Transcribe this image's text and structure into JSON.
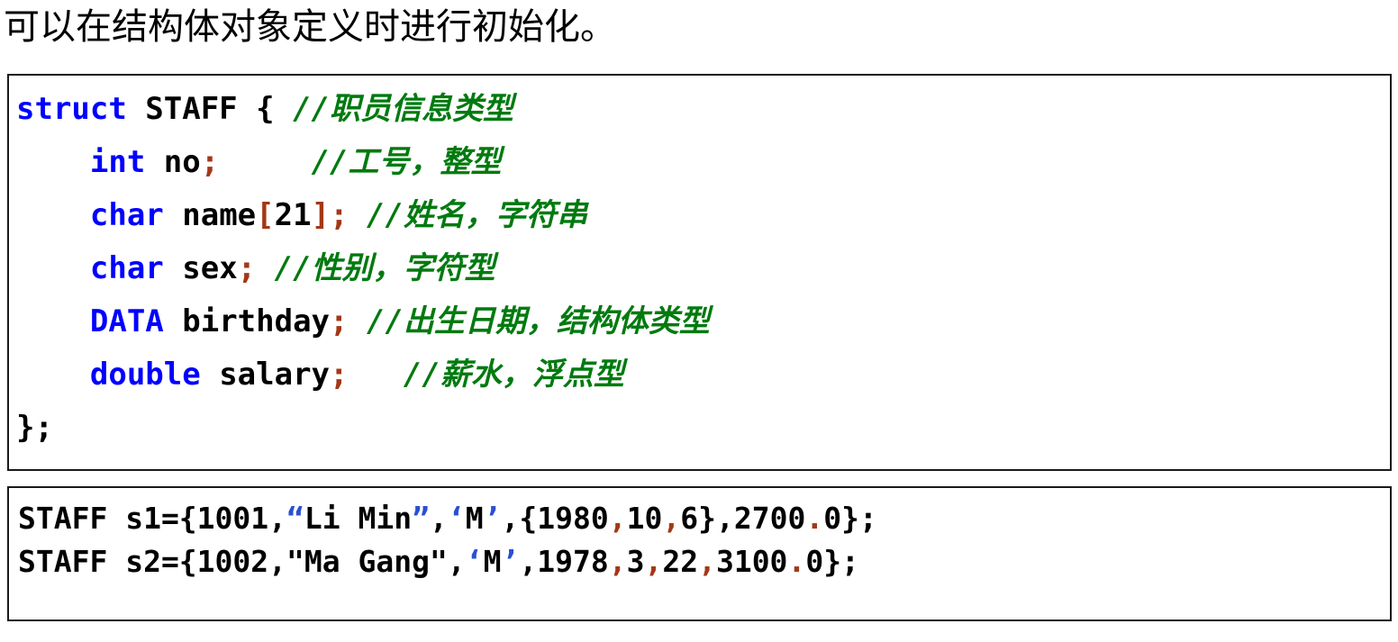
{
  "document": {
    "heading": "可以在结构体对象定义时进行初始化。",
    "colors": {
      "keyword": "#0000ff",
      "plain": "#000000",
      "punctuation": "#a33817",
      "comment": "#007a0f",
      "quote": "#2a4fd6",
      "border": "#1a1a1a",
      "background": "#ffffff"
    }
  },
  "struct_block": {
    "lines": [
      {
        "indent": "",
        "keyword": "struct",
        "code": " STAFF { ",
        "comment": "//职员信息类型"
      },
      {
        "indent": "    ",
        "keyword": "int",
        "code": " no",
        "semi": ";",
        "gap": "     ",
        "comment": "//工号，整型"
      },
      {
        "indent": "    ",
        "keyword": "char",
        "code": " name",
        "bracket_open": "[",
        "size": "21",
        "bracket_close": "]",
        "semi": ";",
        "gap": " ",
        "comment": "//姓名，字符串"
      },
      {
        "indent": "    ",
        "keyword": "char",
        "code": " sex",
        "semi": ";",
        "gap": " ",
        "comment": "//性别，字符型"
      },
      {
        "indent": "    ",
        "keyword": "DATA",
        "code": " birthday",
        "semi": ";",
        "gap": " ",
        "comment": "//出生日期，结构体类型"
      },
      {
        "indent": "    ",
        "keyword": "double",
        "code": " salary",
        "semi": ";",
        "gap": "   ",
        "comment": "//薪水，浮点型"
      },
      {
        "indent": "",
        "keyword": "",
        "code": "};",
        "comment": ""
      }
    ],
    "line1_keyword": "struct",
    "line1_code": " STAFF { ",
    "line1_comment": "//职员信息类型",
    "line2_indent": "    ",
    "line2_keyword": "int",
    "line2_code": " no",
    "line2_semi": ";",
    "line2_gap": "     ",
    "line2_comment": "//工号，整型",
    "line3_indent": "    ",
    "line3_keyword": "char",
    "line3_code": " name",
    "line3_bracket_open": "[",
    "line3_size": "21",
    "line3_bracket_close": "]",
    "line3_semi": ";",
    "line3_gap": " ",
    "line3_comment": "//姓名，字符串",
    "line4_indent": "    ",
    "line4_keyword": "char",
    "line4_code": " sex",
    "line4_semi": ";",
    "line4_gap": " ",
    "line4_comment": "//性别，字符型",
    "line5_indent": "    ",
    "line5_keyword": "DATA",
    "line5_code": " birthday",
    "line5_semi": ";",
    "line5_gap": " ",
    "line5_comment": "//出生日期，结构体类型",
    "line6_indent": "    ",
    "line6_keyword": "double",
    "line6_code": " salary",
    "line6_semi": ";",
    "line6_gap": "   ",
    "line6_comment": "//薪水，浮点型",
    "line7_code": "};"
  },
  "init_block": {
    "line1": {
      "head": "STAFF s1={1001,",
      "str_open": "“",
      "str_value": "Li Min",
      "str_close": "”",
      "comma1": ",",
      "chr_open": "‘",
      "chr_value": "M",
      "chr_close": "’",
      "comma2": ",",
      "brace_open": "{",
      "year": "1980",
      "sep1": ",",
      "month": "10",
      "sep2": ",",
      "day": "6",
      "brace_close": "}",
      "comma3": ",",
      "salary_int": "2700",
      "dot": ".",
      "salary_frac": "0",
      "tail": "};"
    },
    "line2": {
      "head": "STAFF s2={1002,",
      "str_open": "\"",
      "str_value": "Ma Gang",
      "str_close": "\"",
      "comma1": ",",
      "chr_open": "‘",
      "chr_value": "M",
      "chr_close": "’",
      "comma2": ",",
      "year": "1978",
      "sep1": ",",
      "month": "3",
      "sep2": ",",
      "day": "22",
      "comma3": ",",
      "salary_int": "3100",
      "dot": ".",
      "salary_frac": "0",
      "tail": "};"
    }
  }
}
